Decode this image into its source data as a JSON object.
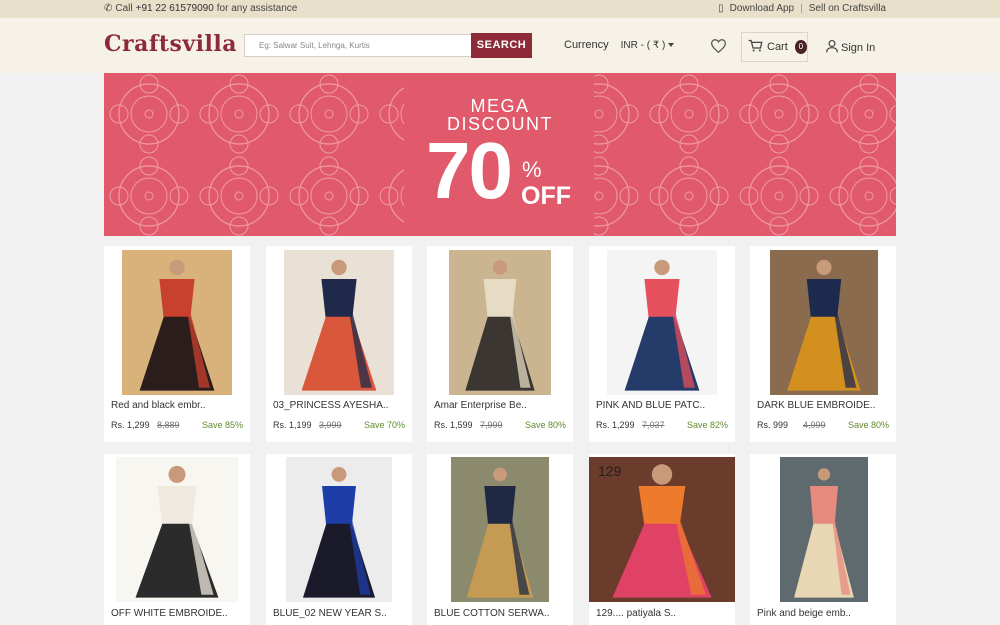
{
  "topbar": {
    "call_prefix": "Call",
    "phone": "+91 22 61579090",
    "call_suffix": "for any assistance",
    "download_app": "Download App",
    "sell": "Sell on Craftsvilla"
  },
  "header": {
    "logo": "Craftsvilla",
    "search_placeholder": "Eg: Salwar Suit, Lehnga, Kurtis",
    "search_button": "SEARCH",
    "currency_label": "Currency",
    "currency_value": "INR - ( ₹ )",
    "cart_label": "Cart",
    "cart_count": "0",
    "signin": "Sign In"
  },
  "banner": {
    "line1": "MEGA",
    "line2": "DISCOUNT",
    "percent": "70",
    "percent_sign": "%",
    "off": "OFF"
  },
  "products": [
    {
      "name": "Red and black embr..",
      "price": "Rs. 1,299",
      "mrp": "8,889",
      "save": "Save 85%",
      "colors": [
        "#c8402e",
        "#2a1d1c",
        "#d8b27a"
      ]
    },
    {
      "name": "03_PRINCESS AYESHA..",
      "price": "Rs. 1,199",
      "mrp": "3,999",
      "save": "Save 70%",
      "colors": [
        "#1f2a4a",
        "#d9573a",
        "#e9e1d6"
      ]
    },
    {
      "name": "Amar Enterprise Be..",
      "price": "Rs. 1,599",
      "mrp": "7,999",
      "save": "Save 80%",
      "colors": [
        "#e6dcc4",
        "#3b3631",
        "#cbb590"
      ]
    },
    {
      "name": "PINK AND BLUE PATC..",
      "price": "Rs. 1,299",
      "mrp": "7,037",
      "save": "Save 82%",
      "colors": [
        "#e5505c",
        "#253b6a",
        "#f4f4f4"
      ]
    },
    {
      "name": "DARK BLUE EMBROIDE..",
      "price": "Rs. 999",
      "mrp": "4,999",
      "save": "Save 80%",
      "colors": [
        "#1c2a4e",
        "#d4901f",
        "#8a6b4e"
      ]
    },
    {
      "name": "OFF WHITE EMBROIDE..",
      "price": "",
      "mrp": "",
      "save": "",
      "colors": [
        "#efe9df",
        "#2b2b2b",
        "#f8f6f1"
      ]
    },
    {
      "name": "BLUE_02 NEW YEAR S..",
      "price": "",
      "mrp": "",
      "save": "",
      "colors": [
        "#1d3ea8",
        "#1a1a2a",
        "#ececec"
      ]
    },
    {
      "name": "BLUE COTTON SERWA..",
      "price": "",
      "mrp": "",
      "save": "",
      "colors": [
        "#1f2944",
        "#c59a52",
        "#8c8a6c"
      ]
    },
    {
      "name": "129.... patiyala S..",
      "price": "",
      "mrp": "",
      "save": "",
      "colors": [
        "#ee7a2c",
        "#e04266",
        "#6b3b2c"
      ]
    },
    {
      "name": "Pink and beige emb..",
      "price": "",
      "mrp": "",
      "save": "",
      "colors": [
        "#e58a7c",
        "#e9d6b4",
        "#5f6a6f"
      ]
    }
  ],
  "product_image_badge": "129",
  "colors": {
    "brand": "#8e2b39",
    "banner": "#e05a6b",
    "save_green": "#5f8c2e"
  }
}
